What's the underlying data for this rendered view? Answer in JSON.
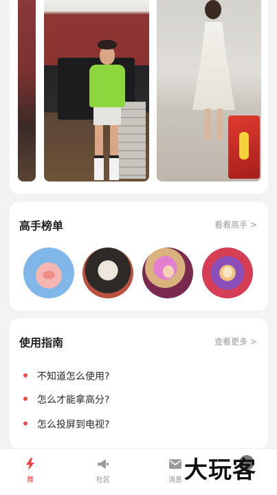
{
  "masters": {
    "title": "高手榜单",
    "more": "看看高手 >",
    "avatars": [
      "pig-avatar",
      "girl-cap-avatar",
      "pink-hood-avatar",
      "cartoon-avatar"
    ]
  },
  "guide": {
    "title": "使用指南",
    "more": "查看更多 >",
    "items": [
      "不知道怎么使用?",
      "怎么才能拿高分?",
      "怎么投屏到电视?"
    ]
  },
  "tabbar": {
    "dance": "舞",
    "community": "社区",
    "message": "消息"
  },
  "watermark": "大玩客",
  "colors": {
    "accent": "#f0413f",
    "inactive": "#8e8e8e",
    "background": "#f3f3f3"
  }
}
